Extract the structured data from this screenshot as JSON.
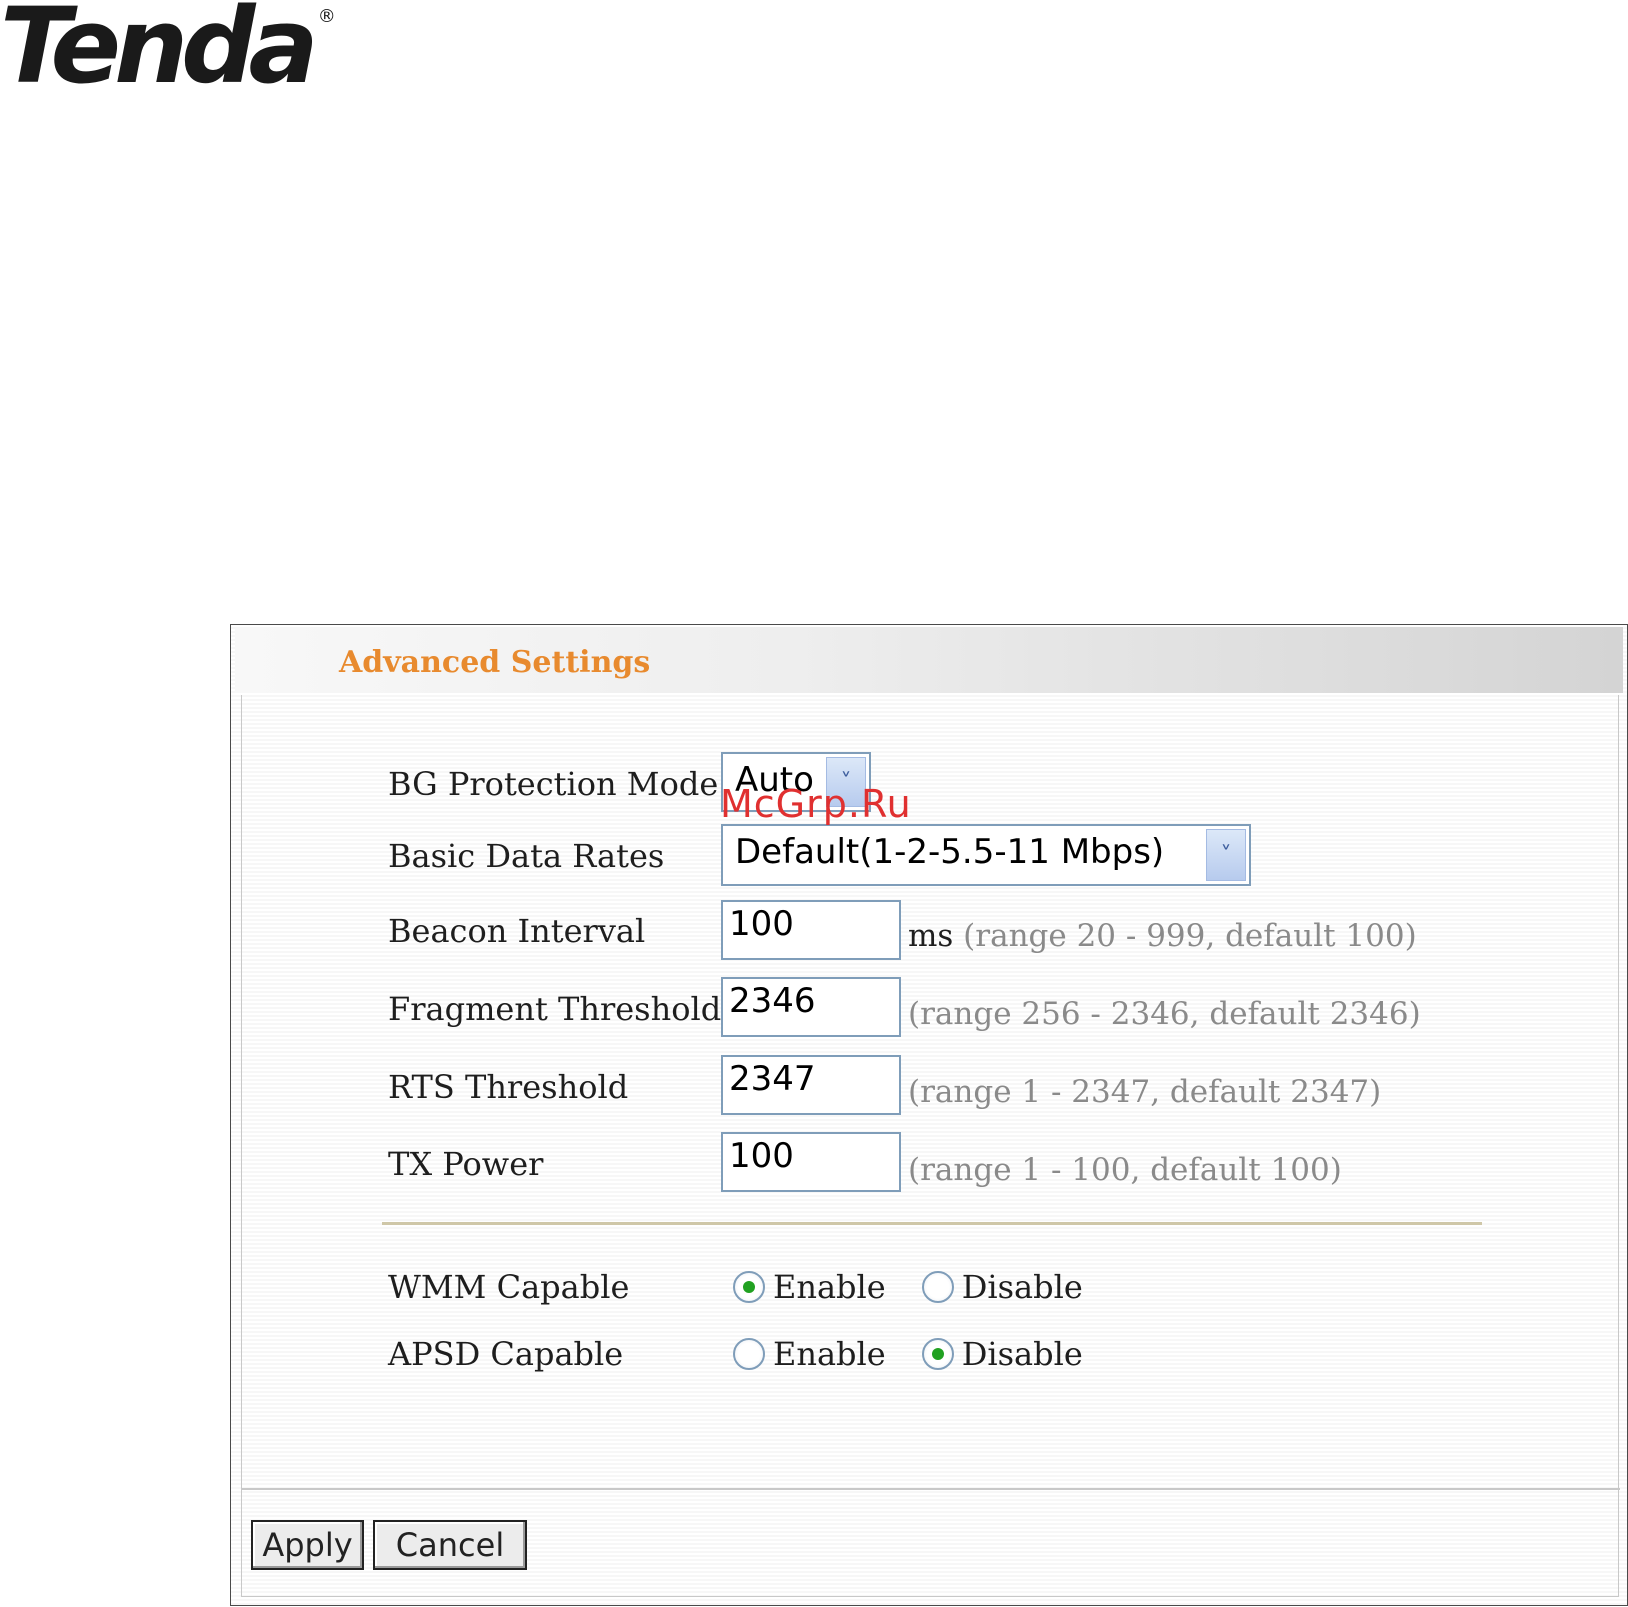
{
  "brand": {
    "logo_text": "Tenda",
    "registered": "®"
  },
  "panel": {
    "title": "Advanced Settings"
  },
  "fields": {
    "bg_protection": {
      "label": "BG Protection Mode",
      "value": "Auto"
    },
    "basic_rates": {
      "label": "Basic Data Rates",
      "value": "Default(1-2-5.5-11 Mbps)"
    },
    "beacon": {
      "label": "Beacon Interval",
      "value": "100",
      "unit": "ms",
      "hint": "(range 20 - 999, default 100)"
    },
    "fragment": {
      "label": "Fragment Threshold",
      "value": "2346",
      "hint": "(range 256 - 2346, default 2346)"
    },
    "rts": {
      "label": "RTS Threshold",
      "value": "2347",
      "hint": "(range 1 - 2347, default 2347)"
    },
    "tx_power": {
      "label": "TX Power",
      "value": "100",
      "hint": "(range 1 - 100, default 100)"
    }
  },
  "radios": {
    "wmm": {
      "label": "WMM Capable",
      "enable": "Enable",
      "disable": "Disable",
      "selected": "enable"
    },
    "apsd": {
      "label": "APSD Capable",
      "enable": "Enable",
      "disable": "Disable",
      "selected": "disable"
    }
  },
  "buttons": {
    "apply": "Apply",
    "cancel": "Cancel"
  },
  "watermark": "McGrp.Ru",
  "colors": {
    "title": "#e88a2e",
    "radio_dot": "#21a121",
    "input_border": "#7f9db9",
    "watermark": "#e03030"
  }
}
